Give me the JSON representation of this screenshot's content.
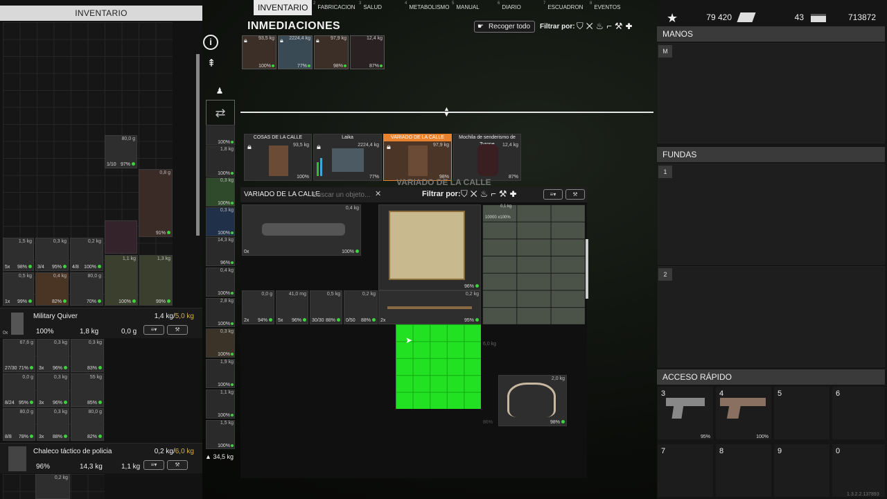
{
  "tabs": [
    {
      "num": "",
      "label": "INVENTARIO"
    },
    {
      "num": "2",
      "label": "FABRICACION"
    },
    {
      "num": "3",
      "label": "SALUD"
    },
    {
      "num": "4",
      "label": "METABOLISMO"
    },
    {
      "num": "5",
      "label": "MANUAL"
    },
    {
      "num": "6",
      "label": "DIARIO"
    },
    {
      "num": "7",
      "label": "ESCUADRON"
    },
    {
      "num": "8",
      "label": "EVENTOS"
    }
  ],
  "left": {
    "title": "INVENTARIO",
    "quiver": {
      "name": "Military Quiver",
      "cap": "1,4 kg/",
      "cap_max": "5,0 kg",
      "stat1": "100%",
      "stat2": "1,8 kg",
      "stat3": "0,0 g",
      "count": "0x"
    },
    "vest": {
      "name": "Chaleco táctico de policia",
      "cap": "0,2 kg/",
      "cap_max": "6,0 kg",
      "stat1": "96%",
      "stat2": "14,3 kg",
      "stat3": "1,1 kg",
      "weight": "0,2 kg"
    },
    "items_top": [
      {
        "w": "80,0 g",
        "p": "97%",
        "q": "1/10"
      },
      {
        "w": "0,8 g",
        "p": "91%",
        "q": ""
      },
      {
        "w": "1,5 kg",
        "p": "98%",
        "q": "5x"
      },
      {
        "w": "0,3 kg",
        "p": "95%",
        "q": "3/4"
      },
      {
        "w": "0,2 kg",
        "p": "100%",
        "q": "4/8"
      },
      {
        "w": "1,1 kg",
        "p": "100%",
        "q": "3/4"
      },
      {
        "w": "1,3 kg",
        "p": "99%",
        "q": ""
      },
      {
        "w": "0,5 kg",
        "p": "99%",
        "q": "1x"
      },
      {
        "w": "0,4 kg",
        "p": "82%",
        "q": ""
      },
      {
        "w": "80,0 g",
        "p": "70%",
        "q": ""
      }
    ],
    "quiver_items": [
      {
        "w": "67,6 g",
        "p": "71%",
        "q": "27/30"
      },
      {
        "w": "0,3 kg",
        "p": "96%",
        "q": "3x"
      },
      {
        "w": "0,3 kg",
        "p": "83%",
        "q": ""
      },
      {
        "w": "0,0 g",
        "p": "95%",
        "q": "8/24"
      },
      {
        "w": "0,3 kg",
        "p": "96%",
        "q": "3x"
      },
      {
        "w": "55 kg",
        "p": "85%",
        "q": ""
      },
      {
        "w": "80,0 g",
        "p": "78%",
        "q": "8/8"
      },
      {
        "w": "0,3 kg",
        "p": "88%",
        "q": "3x"
      },
      {
        "w": "80,0 g",
        "p": "82%",
        "q": ""
      }
    ],
    "weight_total": "34,5 kg"
  },
  "equip": [
    {
      "w": "",
      "p": "100%"
    },
    {
      "w": "1,8 kg",
      "p": "100%"
    },
    {
      "w": "0,3 kg",
      "p": "100%"
    },
    {
      "w": "0,3 kg",
      "p": "100%"
    },
    {
      "w": "14,3 kg",
      "p": "96%"
    },
    {
      "w": "0,4 kg",
      "p": "100%"
    },
    {
      "w": "2,8 kg",
      "p": "100%"
    },
    {
      "w": "0,3 kg",
      "p": "100%"
    },
    {
      "w": "1,9 kg",
      "p": "100%"
    },
    {
      "w": "1,1 kg",
      "p": "100%"
    },
    {
      "w": "1,5 kg",
      "p": "100%"
    }
  ],
  "nearby": {
    "title": "INMEDIACIONES",
    "pickup_all": "Recoger todo",
    "filter_label": "Filtrar por:",
    "chips": [
      {
        "w": "93,5 kg",
        "p": "100%",
        "lock": true
      },
      {
        "w": "2224,4 kg",
        "p": "77%",
        "lock": true
      },
      {
        "w": "97,9 kg",
        "p": "98%",
        "lock": true
      },
      {
        "w": "12,4 kg",
        "p": "87%",
        "lock": false
      }
    ],
    "containers": [
      {
        "name": "COSAS DE LA CALLE",
        "w": "93,5 kg",
        "p": "100%"
      },
      {
        "name": "Laika",
        "w": "2224,4 kg",
        "p": "77%"
      },
      {
        "name": "VARIADO DE LA CALLE",
        "w": "97,9 kg",
        "p": "98%"
      },
      {
        "name": "Mochila de senderismo de Tyrone",
        "w": "12,4 kg",
        "p": "87%"
      }
    ],
    "bg_label": "VARIADO DE LA CALLE"
  },
  "container": {
    "title": "VARIADO DE LA CALLE",
    "search_placeholder": "Buscar un objeto...",
    "filter_label": "Filtrar por:",
    "items": [
      {
        "w": "0,4 kg",
        "p": "100%",
        "q": "0x"
      },
      {
        "w": "",
        "p": "96%",
        "q": ""
      },
      {
        "w": "0,0 g",
        "p": "94%",
        "q": "2x"
      },
      {
        "w": "41,0 mg",
        "p": "96%",
        "q": "5x"
      },
      {
        "w": "0,5 kg",
        "p": "88%",
        "q": "30/30"
      },
      {
        "w": "0,2 kg",
        "p": "88%",
        "q": "0/50"
      },
      {
        "w": "0,2 kg",
        "p": "95%",
        "q": "2x"
      },
      {
        "w": "2,0 kg",
        "p": "98%",
        "q": ""
      },
      {
        "w": "6,0 kg",
        "p": "86%",
        "q": ""
      }
    ],
    "money_w": "0,1 kg",
    "money_p": "10000 x100%"
  },
  "header_stats": {
    "a": "79 420",
    "b": "43",
    "c": "713872"
  },
  "right": {
    "hands": "MANOS",
    "hands_slot": "M",
    "holsters": "FUNDAS",
    "holster_slots": [
      "1",
      "2"
    ],
    "quick": "ACCESO RÁPIDO",
    "quick_slots": [
      {
        "n": "3",
        "p": "95%"
      },
      {
        "n": "4",
        "p": "100%"
      },
      {
        "n": "5",
        "p": ""
      },
      {
        "n": "6",
        "p": ""
      },
      {
        "n": "7",
        "p": ""
      },
      {
        "n": "8",
        "p": ""
      },
      {
        "n": "9",
        "p": ""
      },
      {
        "n": "0",
        "p": ""
      }
    ],
    "version": "1.3.2.2.137893"
  },
  "colors": {
    "accent": "#e8822e",
    "green": "#3bd43b",
    "capacity": "#d9b14a",
    "highlight": "#22e022"
  }
}
